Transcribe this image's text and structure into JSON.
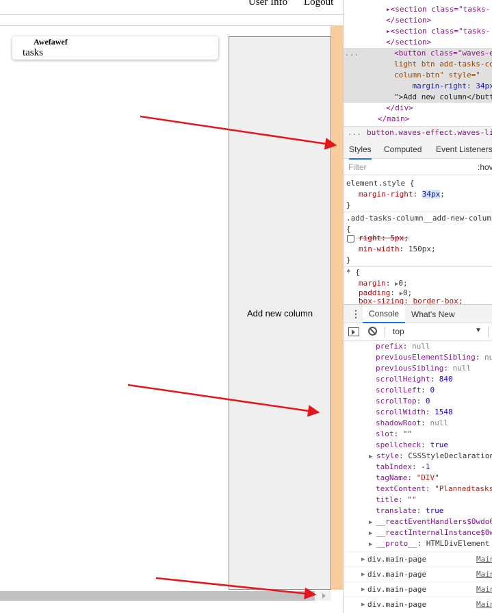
{
  "page": {
    "nav": {
      "user_info": "User Info",
      "logout": "Logout"
    },
    "card": {
      "title": "Awefawef",
      "subtitle": "tasks"
    },
    "add_column_label": "Add new column"
  },
  "devtools": {
    "elements": {
      "lines": [
        {
          "text": "▸<section class=\"tasks-"
        },
        {
          "text": "</section>"
        },
        {
          "text": "▸<section class=\"tasks-"
        },
        {
          "text": "</section>"
        },
        {
          "text": "<button class=\"waves-e"
        },
        {
          "text": "light btn add-tasks-co"
        },
        {
          "text": "column-btn\" style=\""
        },
        {
          "text": "    margin-right: 34px"
        },
        {
          "text": "\">Add new column</butt"
        },
        {
          "text": "</div>"
        },
        {
          "text": "</main>"
        }
      ],
      "ellipsis": "...",
      "breadcrumb": "button.waves-effect.waves-light.btn"
    },
    "tabs": [
      "Styles",
      "Computed",
      "Event Listeners"
    ],
    "filter_placeholder": "Filter",
    "filter_right": ":hov",
    "styles": {
      "rule1_selector": "element.style {",
      "rule1_prop": "margin-right",
      "rule1_val": "34px",
      "rule1_close": "}",
      "rule2_selector": ".add-tasks-column__add-new-column",
      "rule2_open": "{",
      "rule2_prop1": "right: 5px;",
      "rule2_prop2": "min-width",
      "rule2_val2": "150px",
      "rule2_close": "}",
      "rule3_selector": "* {",
      "rule3_prop1": "margin",
      "rule3_val1": "0",
      "rule3_prop2": "padding",
      "rule3_val2": "0",
      "rule3_prop3": "box-sizing: border-box;"
    },
    "console": {
      "tabs": [
        "Console",
        "What's New"
      ],
      "context": "top",
      "props": [
        {
          "k": "prefix",
          "v": "null",
          "t": "null"
        },
        {
          "k": "previousElementSibling",
          "v": "nu",
          "t": "null"
        },
        {
          "k": "previousSibling",
          "v": "null",
          "t": "null"
        },
        {
          "k": "scrollHeight",
          "v": "840",
          "t": "num"
        },
        {
          "k": "scrollLeft",
          "v": "0",
          "t": "num"
        },
        {
          "k": "scrollTop",
          "v": "0",
          "t": "num"
        },
        {
          "k": "scrollWidth",
          "v": "1548",
          "t": "num"
        },
        {
          "k": "shadowRoot",
          "v": "null",
          "t": "null"
        },
        {
          "k": "slot",
          "v": "\"\"",
          "t": "str"
        },
        {
          "k": "spellcheck",
          "v": "true",
          "t": "num"
        },
        {
          "k": "style",
          "v": "CSSStyleDeclaration",
          "t": "null",
          "expand": true
        },
        {
          "k": "tabIndex",
          "v": "-1",
          "t": "num"
        },
        {
          "k": "tagName",
          "v": "\"DIV\"",
          "t": "str"
        },
        {
          "k": "textContent",
          "v": "\"Plannedtasks",
          "t": "str"
        },
        {
          "k": "title",
          "v": "\"\"",
          "t": "str"
        },
        {
          "k": "translate",
          "v": "true",
          "t": "num"
        },
        {
          "k": "__reactEventHandlers$0wdo6",
          "v": "",
          "t": "null",
          "expand": true
        },
        {
          "k": "__reactInternalInstance$0w",
          "v": "",
          "t": "null",
          "expand": true
        },
        {
          "k": "__proto__",
          "v": "HTMLDivElement",
          "t": "null",
          "expand": true
        }
      ],
      "logs": [
        {
          "text": "div.main-page",
          "src": "Main"
        },
        {
          "text": "div.main-page",
          "src": "Main"
        },
        {
          "text": "div.main-page",
          "src": "Main"
        },
        {
          "text": "div.main-page",
          "src": "Main"
        }
      ]
    }
  },
  "colors": {
    "highlight_orange": "#f9cc9d",
    "arrow_red": "#e8141c",
    "devtools_active_tab": "#1a73e8"
  }
}
